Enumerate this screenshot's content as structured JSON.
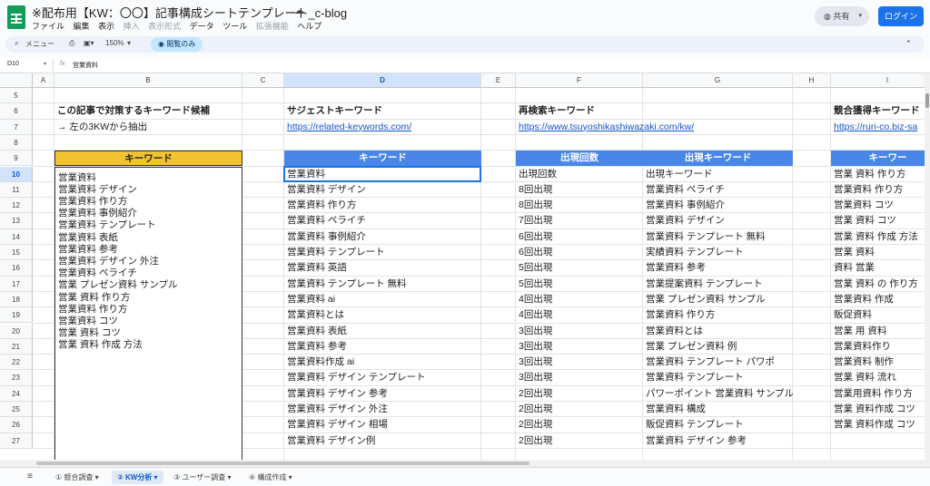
{
  "app": {
    "title": "※配布用【KW：〇〇】記事構成シートテンプレート_c-blog",
    "menu": [
      "ファイル",
      "編集",
      "表示",
      "挿入",
      "表示形式",
      "データ",
      "ツール",
      "拡張機能",
      "ヘルプ"
    ],
    "share_label": "共有",
    "login_label": "ログイン"
  },
  "toolbar": {
    "menu_label": "メニュー",
    "zoom": "150%",
    "view_only_label": "閲覧のみ"
  },
  "formula": {
    "cell_ref": "D10",
    "content": "営業資料"
  },
  "columns": [
    "A",
    "B",
    "C",
    "D",
    "E",
    "F",
    "G",
    "H",
    "I"
  ],
  "rows": [
    "5",
    "6",
    "7",
    "8",
    "9",
    "10",
    "11",
    "12",
    "13",
    "14",
    "15",
    "16",
    "17",
    "18",
    "19",
    "20",
    "21",
    "22",
    "23",
    "24",
    "25",
    "26",
    "27"
  ],
  "sections": {
    "b_title": "この記事で対策するキーワード候補",
    "b_subtitle": "→ 左の3KWから抽出",
    "d_title": "サジェストキーワード",
    "d_link": "https://related-keywords.com/",
    "f_title": "再検索キーワード",
    "f_link": "https://www.tsuyoshikashiwazaki.com/kw/",
    "i_title": "競合獲得キーワード",
    "i_link": "https://ruri-co.biz-sa"
  },
  "headers": {
    "b": "キーワード",
    "d": "キーワード",
    "f": "出現回数",
    "g": "出現キーワード",
    "i": "キーワー"
  },
  "keyword_candidates": [
    "営業資料",
    "営業資料 デザイン",
    "営業資料 作り方",
    "営業資料 事例紹介",
    "営業資料 テンプレート",
    "営業資料 表紙",
    "営業資料 参考",
    "営業資料 デザイン 外注",
    "営業資料 ペライチ",
    "営業 プレゼン資料 サンプル",
    "営業 資料 作り方",
    "営業資料 作り方",
    "営業資料 コツ",
    "営業 資料 コツ",
    "営業 資料 作成 方法"
  ],
  "col_d": [
    "営業資料",
    "営業資料 デザイン",
    "営業資料 作り方",
    "営業資料 ペライチ",
    "営業資料 事例紹介",
    "営業資料 テンプレート",
    "営業資料 英語",
    "営業資料 テンプレート 無料",
    "営業資料 ai",
    "営業資料とは",
    "営業資料 表紙",
    "営業資料 参考",
    "営業資料作成 ai",
    "営業資料 デザイン テンプレート",
    "営業資料 デザイン 参考",
    "営業資料 デザイン 外注",
    "営業資料 デザイン 相場",
    "営業資料 デザイン例"
  ],
  "col_f": [
    "出現回数",
    "8回出現",
    "8回出現",
    "7回出現",
    "6回出現",
    "6回出現",
    "5回出現",
    "5回出現",
    "4回出現",
    "4回出現",
    "3回出現",
    "3回出現",
    "3回出現",
    "3回出現",
    "2回出現",
    "2回出現",
    "2回出現",
    "2回出現"
  ],
  "col_g": [
    "出現キーワード",
    "営業資料 ペライチ",
    "営業資料 事例紹介",
    "営業資料 デザイン",
    "営業資料 テンプレート 無料",
    "実績資料 テンプレート",
    "営業資料 参考",
    "営業提案資料 テンプレート",
    "営業 プレゼン資料 サンプル",
    "営業資料 作り方",
    "営業資料とは",
    "営業 プレゼン資料 例",
    "営業資料 テンプレート パワポ",
    "営業資料 テンプレート",
    "パワーポイント 営業資料 サンプル",
    "営業資料 構成",
    "販促資料 テンプレート",
    "営業資料 デザイン 参考"
  ],
  "col_i": [
    "営業 資料 作り方",
    "営業資料 作り方",
    "営業資料 コツ",
    "営業 資料 コツ",
    "営業 資料 作成 方法",
    "営業 資料",
    "資料 営業",
    "営業 資料 の 作り方",
    "営業資料 作成",
    "販促資料",
    "営業 用 資料",
    "営業資料作り",
    "営業資料 制作",
    "営業 資料 流れ",
    "営業用資料 作り方",
    "営業 資料作成 コツ",
    "営業 資料作成 コツ"
  ],
  "sheet_tabs": [
    "① 競合調査",
    "② KW分析",
    "③ ユーザー調査",
    "④ 構成作成"
  ],
  "active_tab": "② KW分析"
}
